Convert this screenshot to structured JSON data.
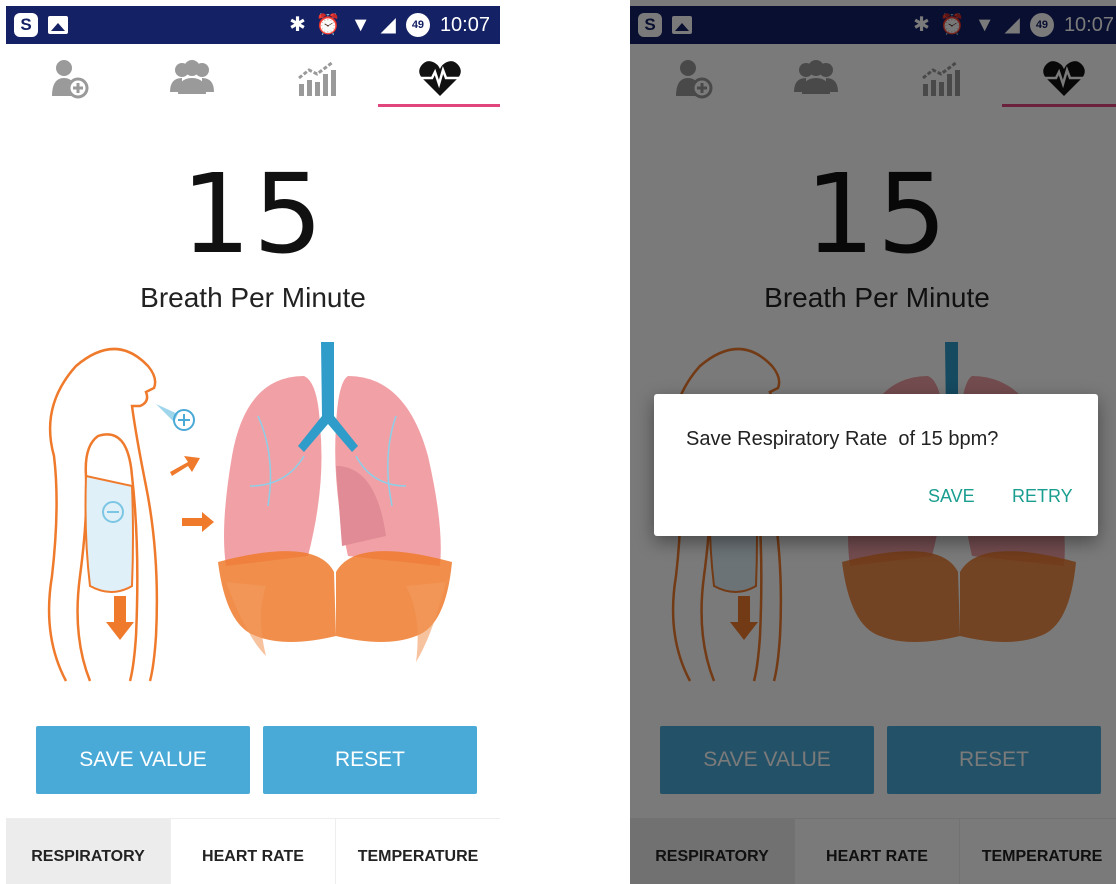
{
  "status_bar": {
    "time": "10:07",
    "battery_level": "49"
  },
  "top_tabs": [
    {
      "icon": "add-patient-icon"
    },
    {
      "icon": "patients-group-icon"
    },
    {
      "icon": "statistics-chart-icon"
    },
    {
      "icon": "heart-rate-icon",
      "active": true
    }
  ],
  "measurement": {
    "value": "15",
    "unit_label": "Breath Per Minute"
  },
  "buttons": {
    "save_label": "SAVE VALUE",
    "reset_label": "RESET"
  },
  "bottom_tabs": [
    {
      "label": "RESPIRATORY",
      "active": true
    },
    {
      "label": "HEART RATE"
    },
    {
      "label": "TEMPERATURE"
    }
  ],
  "dialog": {
    "message": "Save Respiratory Rate  of 15 bpm?",
    "save_label": "SAVE",
    "retry_label": "RETRY"
  },
  "colors": {
    "status_bar": "#142165",
    "accent": "#e0457b",
    "button": "#4aaad7",
    "dialog_action": "#1a9e8f"
  }
}
